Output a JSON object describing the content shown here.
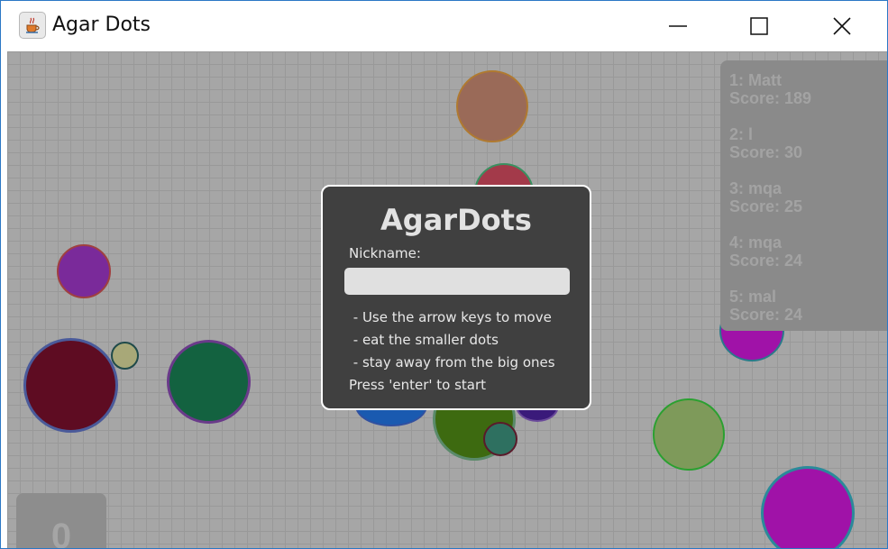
{
  "window": {
    "title": "Agar Dots",
    "icon": "java-cup-icon",
    "controls": [
      "minimize-icon",
      "maximize-icon",
      "close-icon"
    ]
  },
  "leaderboard": [
    {
      "rank_name": "1: Matt",
      "score": "Score: 189"
    },
    {
      "rank_name": "2: l",
      "score": "Score: 30"
    },
    {
      "rank_name": "3: mqa",
      "score": "Score: 25"
    },
    {
      "rank_name": "4: mqa",
      "score": "Score: 24"
    },
    {
      "rank_name": "5: mal",
      "score": "Score: 24"
    }
  ],
  "player_score": "0",
  "dialog": {
    "title": "AgarDots",
    "nickname_label": "Nickname:",
    "nickname_value": "",
    "instructions": [
      " - Use the arrow keys to move",
      " - eat the smaller dots",
      " - stay away from the big ones"
    ],
    "start_hint": "Press 'enter' to start"
  },
  "colors": {
    "background": "#a6a6a6",
    "grid": "#999999",
    "dialog_bg": "#404040",
    "leaderboard_bg": "#8a8a8a"
  }
}
